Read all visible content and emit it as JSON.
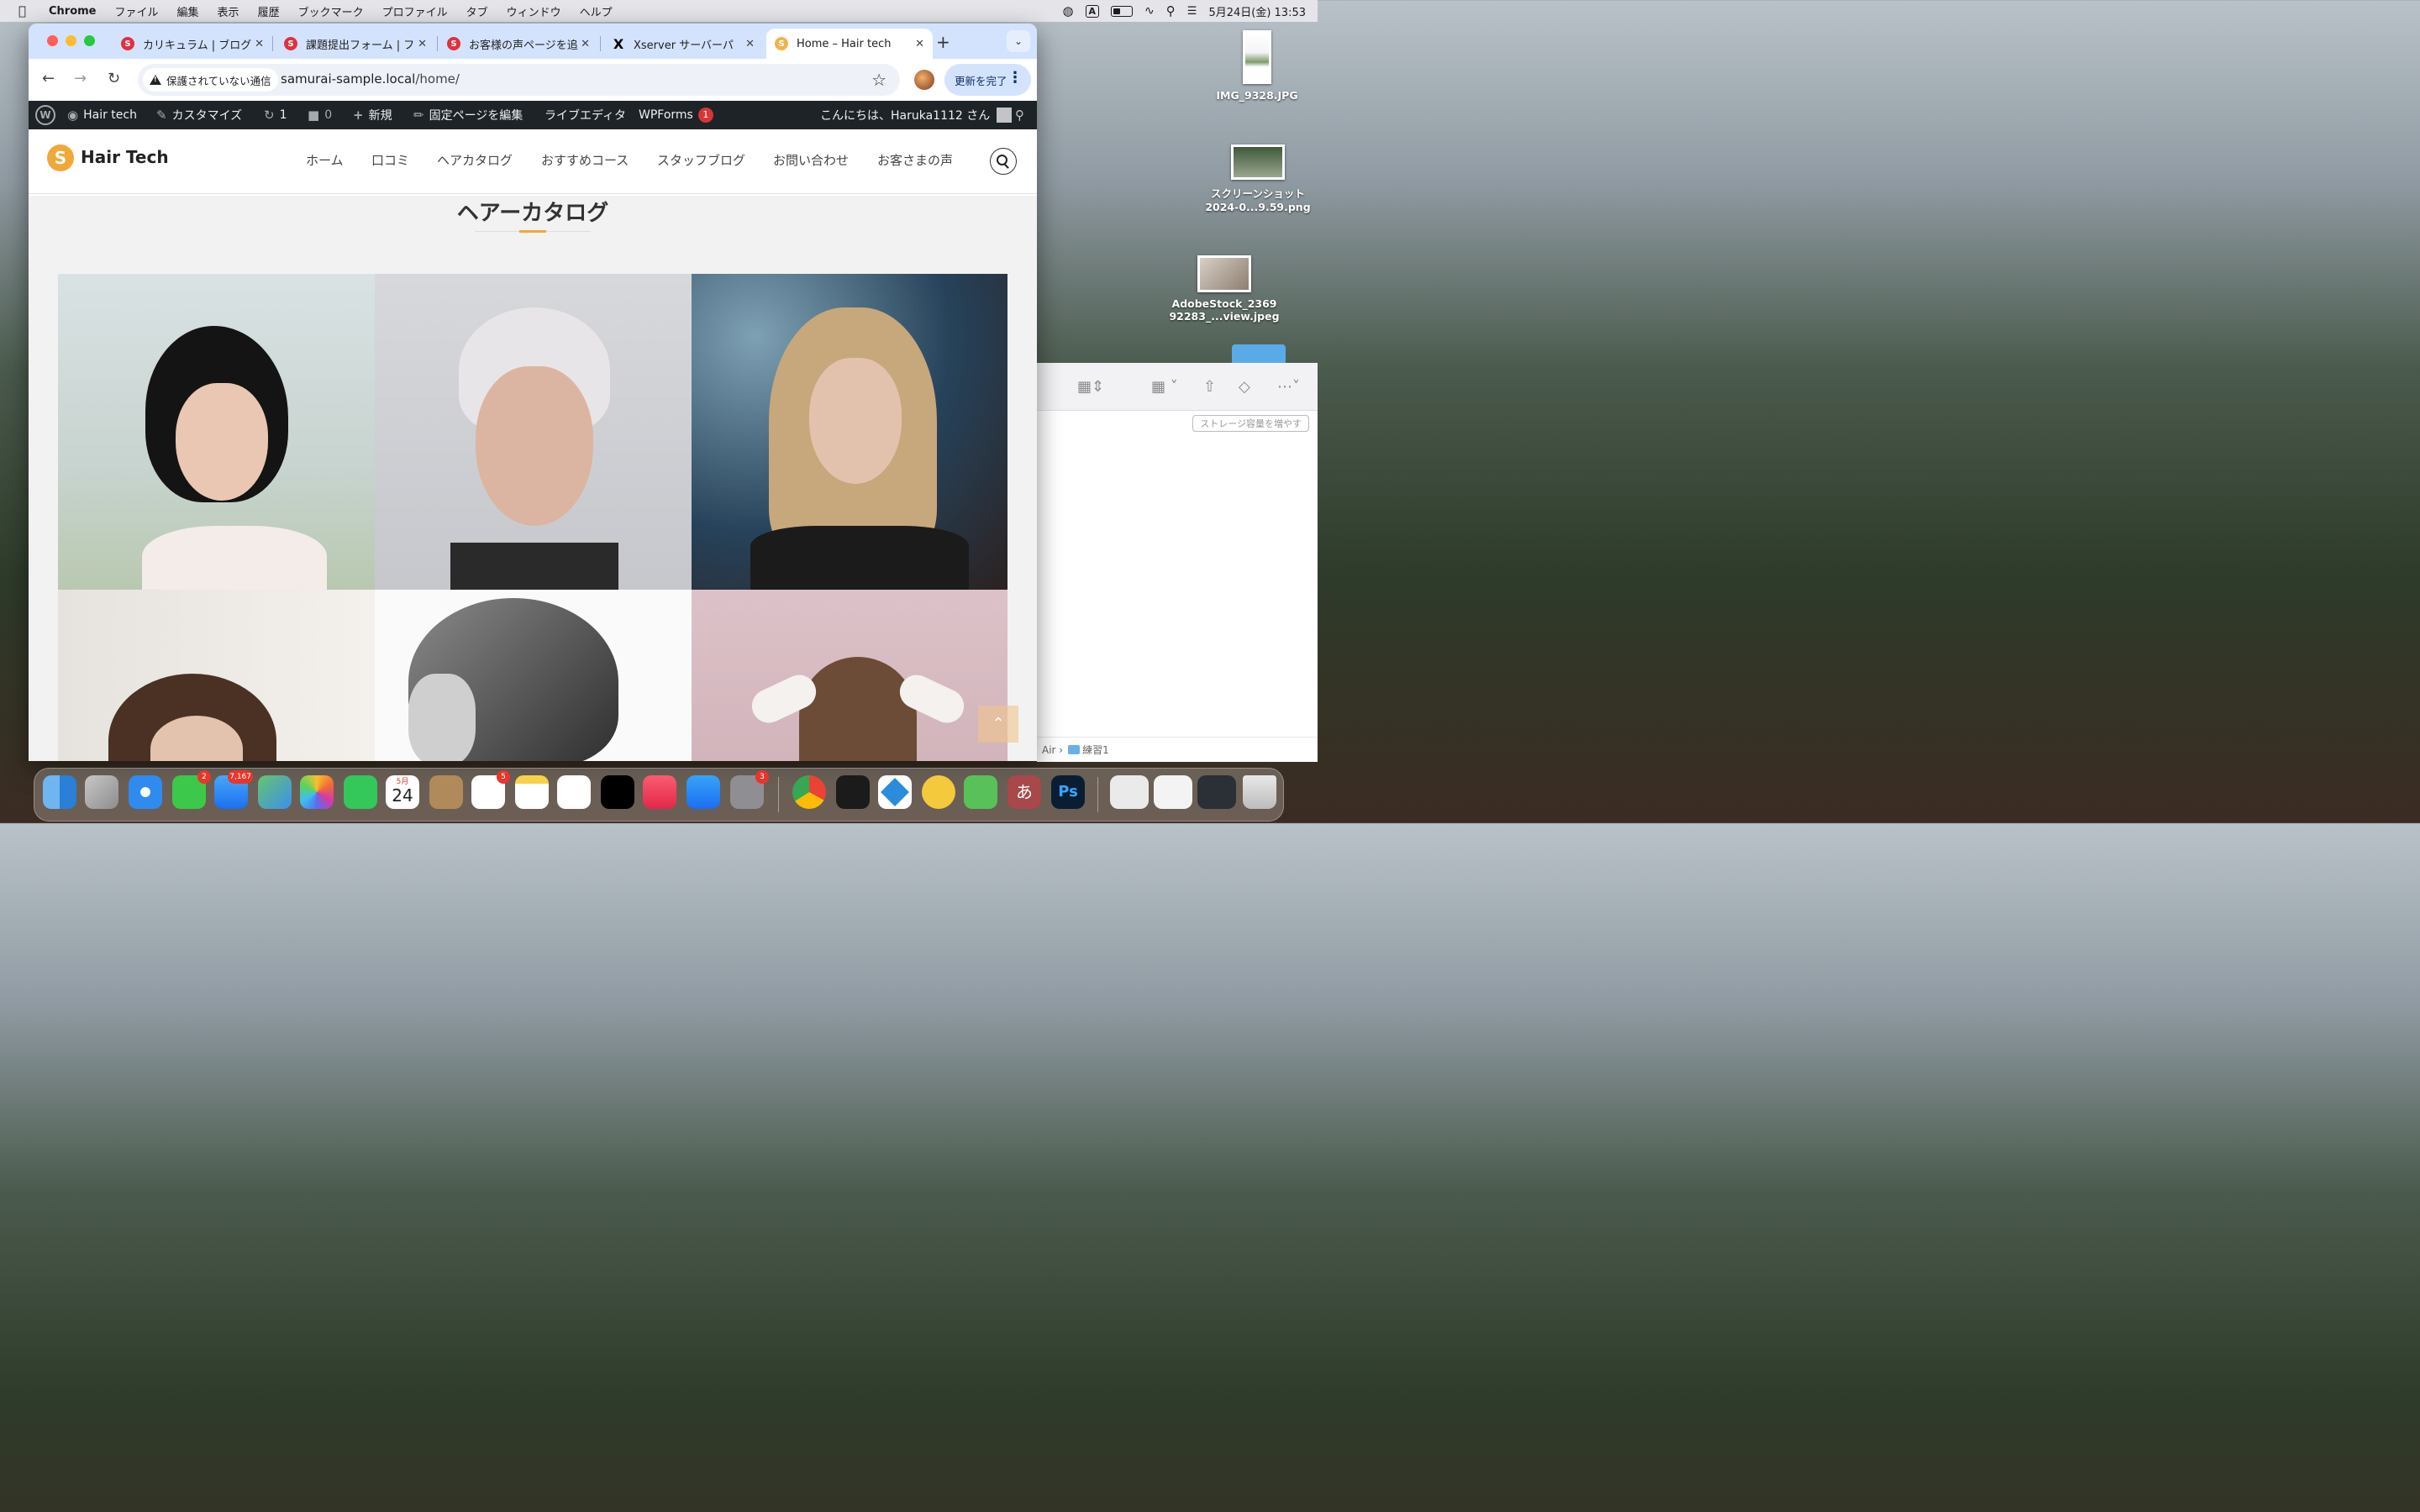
{
  "menubar": {
    "app": "Chrome",
    "items": [
      "ファイル",
      "編集",
      "表示",
      "履歴",
      "ブックマーク",
      "プロファイル",
      "タブ",
      "ウィンドウ",
      "ヘルプ"
    ],
    "input_mode": "A",
    "datetime": "5月24日(金)  13:53"
  },
  "desktop": {
    "icons": [
      {
        "label": "IMG_9328.JPG"
      },
      {
        "label": "スクリーンショット\n2024-0...9.59.png"
      },
      {
        "label": "AdobeStock_2369\n92283_...view.jpeg"
      }
    ]
  },
  "finder": {
    "storage_button": "ストレージ容量を増やす",
    "path_prev": "Air",
    "path_folder": "練習1"
  },
  "tabs": [
    {
      "label": "カリキュラム | ブログ",
      "icon": "samurai-icon"
    },
    {
      "label": "課題提出フォーム | フ",
      "icon": "samurai-icon"
    },
    {
      "label": "お客様の声ページを追",
      "icon": "samurai-icon"
    },
    {
      "label": "Xserver サーバーパ",
      "icon": "x-icon"
    },
    {
      "label": "Home – Hair tech",
      "icon": "hairtech-icon",
      "active": true
    }
  ],
  "toolbar": {
    "security_label": "保護されていない通信",
    "url_host": "samurai-sample.local",
    "url_path": "/home/",
    "update_label": "更新を完了"
  },
  "wp_admin_bar": {
    "site_name": "Hair tech",
    "customize": "カスタマイズ",
    "updates_count": "1",
    "comments_count": "0",
    "new_label": "新規",
    "edit_page": "固定ページを編集",
    "live_editor": "ライブエディタ",
    "wpforms": "WPForms",
    "wpforms_badge": "1",
    "greeting": "こんにちは、Haruka1112 さん"
  },
  "site": {
    "logo_mark": "S",
    "logo_text": "Hair Tech",
    "nav": [
      "ホーム",
      "口コミ",
      "ヘアカタログ",
      "おすすめコース",
      "スタッフブログ",
      "お問い合わせ",
      "お客さまの声"
    ],
    "section_title": "ヘアーカタログ",
    "accent_color": "#f0a838"
  },
  "dock": {
    "badges": {
      "messages": "2",
      "mail": "7,167",
      "reminders": "5",
      "settings": "3"
    },
    "calendar_month": "5月",
    "calendar_day": "24"
  }
}
